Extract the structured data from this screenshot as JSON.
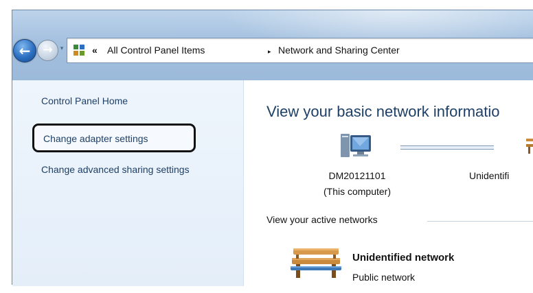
{
  "navigation": {
    "back_icon": "back-arrow-icon",
    "forward_icon": "forward-arrow-icon",
    "history_icon": "chevron-down-icon"
  },
  "address_bar": {
    "overflow": "«",
    "crumbs": [
      "All Control Panel Items",
      "Network and Sharing Center"
    ],
    "separator": "▸",
    "icon": "control-panel-icon"
  },
  "sidebar": {
    "home": "Control Panel Home",
    "links": [
      "Change adapter settings",
      "Change advanced sharing settings"
    ],
    "highlight_color": "#111111"
  },
  "main": {
    "heading": "View your basic network informatio",
    "computer": {
      "name": "DM20121101",
      "subtitle": "(This computer)",
      "icon": "computer-icon"
    },
    "remote_label": "Unidentifi",
    "active_networks_label": "View your active networks",
    "network": {
      "name": "Unidentified network",
      "type": "Public network",
      "icon": "bench-icon"
    }
  },
  "colors": {
    "link": "#1e3f66",
    "titlebar": "#a4c0df",
    "sidebar_bg": "#e4eef9"
  }
}
